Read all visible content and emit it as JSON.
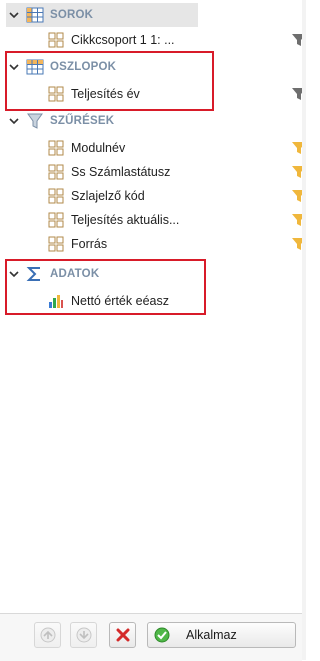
{
  "sections": {
    "rows": {
      "label": "SOROK",
      "fields": [
        {
          "label": "Cikkcsoport 1 1: ..."
        }
      ]
    },
    "columns": {
      "label": "OSZLOPOK",
      "fields": [
        {
          "label": "Teljesítés év"
        }
      ]
    },
    "filters": {
      "label": "SZŰRÉSEK",
      "fields": [
        {
          "label": "Modulnév"
        },
        {
          "label": "Ss Számlastátusz"
        },
        {
          "label": "Szlajelző kód"
        },
        {
          "label": "Teljesítés aktuális..."
        },
        {
          "label": "Forrás"
        }
      ]
    },
    "data": {
      "label": "ADATOK",
      "fields": [
        {
          "label": "Nettó érték eéasz"
        }
      ]
    }
  },
  "toolbar": {
    "apply_label": "Alkalmaz"
  },
  "icons": {
    "grid": "grid-icon",
    "filter": "filter-icon",
    "sum": "sigma-icon",
    "bar": "bar-chart-icon",
    "up": "move-up-icon",
    "down": "move-down-icon",
    "remove": "remove-icon",
    "apply": "check-icon"
  },
  "colors": {
    "highlight_box": "#d81b29",
    "filter_active": "#f0b73c",
    "filter_inactive": "#6e6e6e",
    "section_label": "#7b8fa6"
  }
}
